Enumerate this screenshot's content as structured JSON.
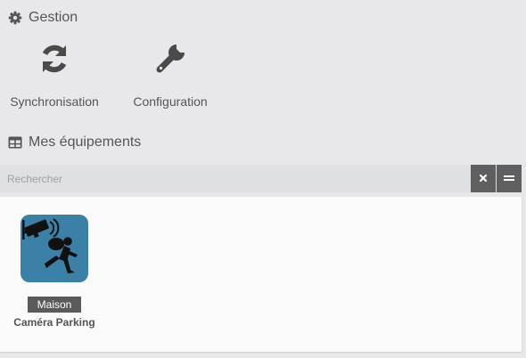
{
  "gestion": {
    "title": "Gestion",
    "title_icon": "gear-icon",
    "actions": [
      {
        "label": "Synchronisation",
        "icon": "sync-icon"
      },
      {
        "label": "Configuration",
        "icon": "wrench-icon"
      }
    ]
  },
  "equipements": {
    "title": "Mes équipements",
    "title_icon": "table-icon",
    "search": {
      "placeholder": "Rechercher",
      "value": ""
    },
    "items": [
      {
        "object": "Maison",
        "name": "Caméra Parking",
        "icon": "burglar-camera-icon"
      }
    ]
  },
  "colors": {
    "background": "#e8e8ea",
    "panel": "#fafafa",
    "icon_dark": "#4a4a4a",
    "button": "#5f5f5f",
    "thumb_blue": "#3a80a7"
  }
}
